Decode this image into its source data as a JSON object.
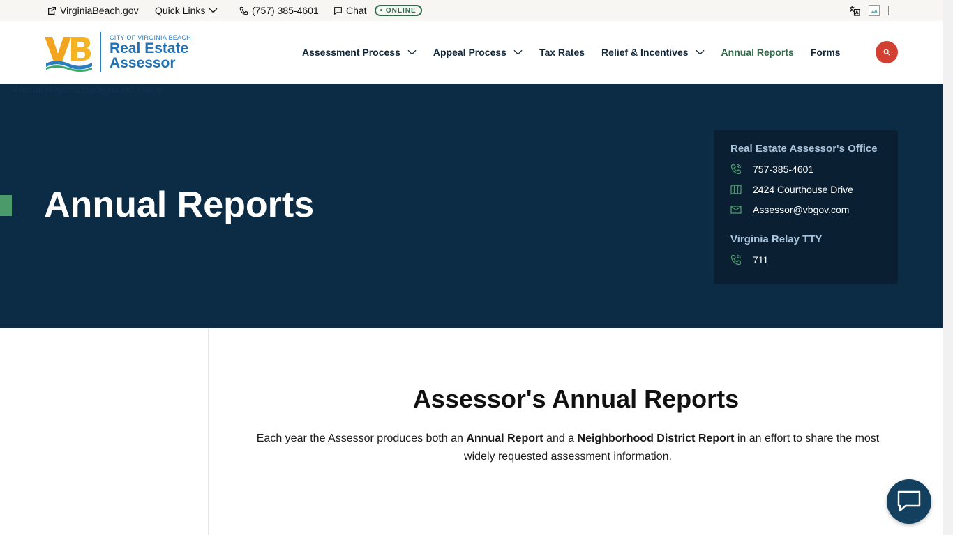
{
  "topbar": {
    "site_link": "VirginiaBeach.gov",
    "quick_links": "Quick Links",
    "phone": "(757) 385-4601",
    "chat": "Chat",
    "chat_status": "• ONLINE"
  },
  "logo": {
    "city": "CITY OF VIRGINIA BEACH",
    "line1": "Real Estate",
    "line2": "Assessor"
  },
  "nav": {
    "items": [
      {
        "label": "Assessment Process"
      },
      {
        "label": "Appeal Process"
      },
      {
        "label": "Tax Rates"
      },
      {
        "label": "Relief & Incentives"
      },
      {
        "label": "Annual Reports"
      },
      {
        "label": "Forms"
      }
    ]
  },
  "hero": {
    "broken_image_alt": "Annual Reports background image",
    "title": "Annual Reports"
  },
  "contact": {
    "office_heading": "Real Estate Assessor's Office",
    "phone": "757-385-4601",
    "address": "2424 Courthouse Drive",
    "email": "Assessor@vbgov.com",
    "relay_heading": "Virginia Relay TTY",
    "relay_phone": "711"
  },
  "content": {
    "title": "Assessor's Annual Reports",
    "text_1": "Each year the Assessor produces both an ",
    "bold_1": "Annual Report",
    "text_2": " and a ",
    "bold_2": "Neighborhood District Report",
    "text_3": " in an effort to share the most widely requested assessment information."
  },
  "colors": {
    "hero_bg": "#0c2b44",
    "card_bg": "#0a1f31",
    "accent_green": "#2e6b4a",
    "search_red": "#d14031",
    "brand_blue": "#1e73b8"
  }
}
